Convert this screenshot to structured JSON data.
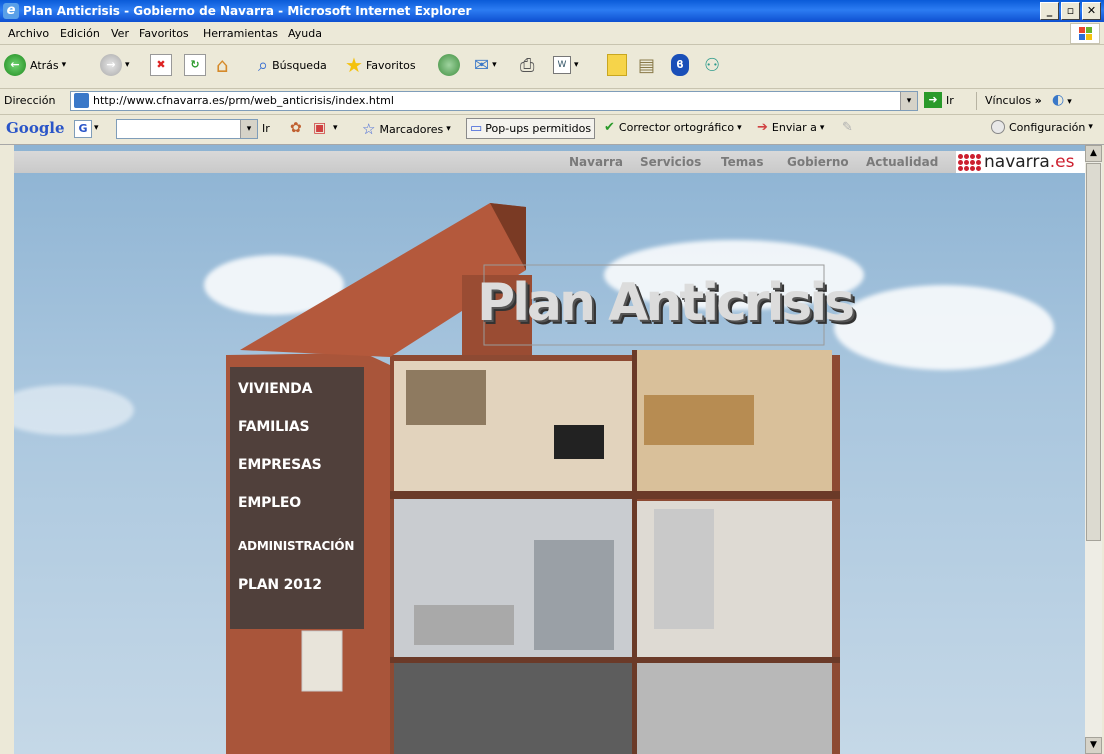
{
  "window": {
    "title": "Plan Anticrisis - Gobierno de Navarra - Microsoft Internet Explorer"
  },
  "menu": [
    "Archivo",
    "Edición",
    "Ver",
    "Favoritos",
    "Herramientas",
    "Ayuda"
  ],
  "toolbar": {
    "back_label": "Atrás",
    "search_label": "Búsqueda",
    "favorites_label": "Favoritos"
  },
  "address": {
    "label": "Dirección",
    "url": "http://www.cfnavarra.es/prm/web_anticrisis/index.html",
    "go_label": "Ir",
    "links_label": "Vínculos"
  },
  "google_bar": {
    "brand": "Google",
    "go_label": "Ir",
    "bookmarks_label": "Marcadores",
    "popups_label": "Pop-ups permitidos",
    "spell_label": "Corrector ortográfico",
    "send_label": "Enviar a",
    "settings_label": "Configuración"
  },
  "site_nav": [
    "Navarra",
    "Servicios",
    "Temas",
    "Gobierno",
    "Actualidad"
  ],
  "logo": {
    "main": "navarra",
    "tld": ".es"
  },
  "hero_title": "Plan Anticrisis",
  "side_menu": [
    "VIVIENDA",
    "FAMILIAS",
    "EMPRESAS",
    "EMPLEO",
    "ADMINISTRACIÓN",
    "PLAN 2012"
  ],
  "colors": {
    "title_bar": "#0a5bd8",
    "logo_red": "#cc1f2f",
    "brick": "#a9553a"
  }
}
